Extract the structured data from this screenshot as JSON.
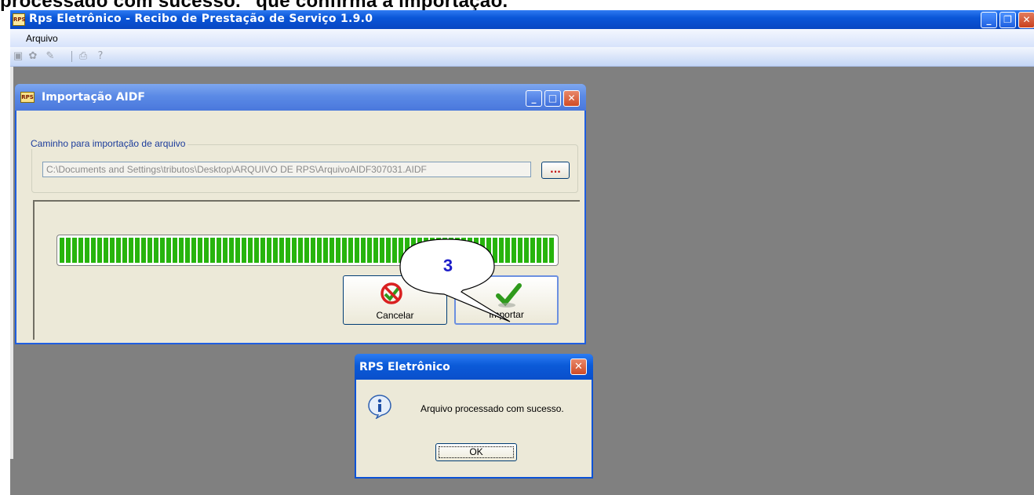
{
  "caption": "processado com sucesso.” que confirma a importação.",
  "main_window": {
    "app_icon_text": "RPS",
    "title": "Rps Eletrônico - Recibo de Prestação de Serviço 1.9.0",
    "menu": [
      "Arquivo"
    ],
    "toolbar_icons": [
      "save-icon",
      "gear-icon",
      "edit-icon",
      "print-icon",
      "help-icon"
    ]
  },
  "import_dialog": {
    "icon_text": "RPS",
    "title": "Importação AIDF",
    "group_label": "Caminho para importação de arquivo",
    "path_value": "C:\\Documents and Settings\\tributos\\Desktop\\ARQUIVO DE RPS\\ArquivoAIDF307031.AIDF",
    "browse_label": "...",
    "progress_fraction": 1.0,
    "progress_color": "#27b40d",
    "cancel_label": "Cancelar",
    "import_label": "Importar"
  },
  "callout": {
    "number": "3",
    "color": "#1c1cc8"
  },
  "message_box": {
    "title": "RPS Eletrônico",
    "icon": "info-icon",
    "message": "Arquivo processado com sucesso.",
    "ok_label": "OK"
  }
}
